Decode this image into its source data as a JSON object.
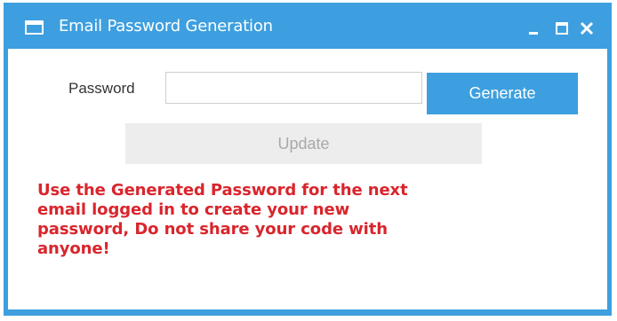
{
  "window": {
    "title": "Email Password Generation",
    "controls": {
      "minimize": "minimize-icon",
      "maximize": "maximize-icon",
      "close": "close-icon"
    },
    "accent_color": "#3d9fdf"
  },
  "form": {
    "password_label": "Password",
    "password_value": "",
    "generate_label": "Generate",
    "update_label": "Update",
    "update_enabled": false
  },
  "notice": {
    "color": "#d9252c",
    "lines": [
      "Use the Generated Password for the next",
      "email logged in to create your new",
      "password, Do not share your code with",
      "anyone!"
    ]
  }
}
